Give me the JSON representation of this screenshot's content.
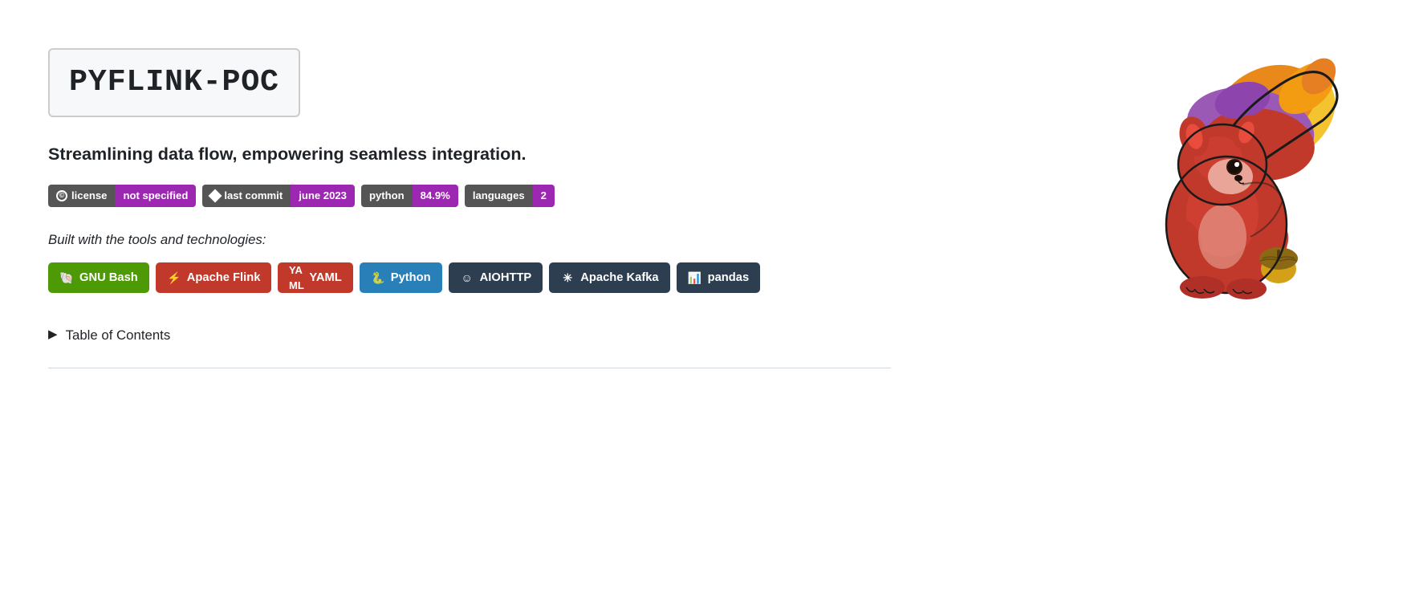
{
  "header": {
    "repo_title": "PYFLINK-POC",
    "tagline": "Streamlining data flow, empowering seamless integration."
  },
  "badges": {
    "license_label": "license",
    "license_value": "not specified",
    "commit_label": "last commit",
    "commit_value": "june 2023",
    "python_label": "python",
    "python_value": "84.9%",
    "languages_label": "languages",
    "languages_value": "2"
  },
  "tools_section": {
    "label": "Built with the tools and technologies:",
    "technologies": [
      {
        "name": "GNU Bash",
        "color": "tech-gnu-bash",
        "icon": "🐚"
      },
      {
        "name": "Apache Flink",
        "color": "tech-apache-flink",
        "icon": "⚡"
      },
      {
        "name": "YAML",
        "color": "tech-yaml",
        "icon": "Y"
      },
      {
        "name": "Python",
        "color": "tech-python",
        "icon": "🐍"
      },
      {
        "name": "AIOHTTP",
        "color": "tech-aiohttp",
        "icon": "☻"
      },
      {
        "name": "Apache Kafka",
        "color": "tech-apache-kafka",
        "icon": "✳"
      },
      {
        "name": "pandas",
        "color": "tech-pandas",
        "icon": "📊"
      }
    ]
  },
  "toc": {
    "label": "Table of Contents"
  },
  "colors": {
    "accent_purple": "#9c27b0",
    "badge_dark": "#555555",
    "divider": "#d0d7de"
  }
}
